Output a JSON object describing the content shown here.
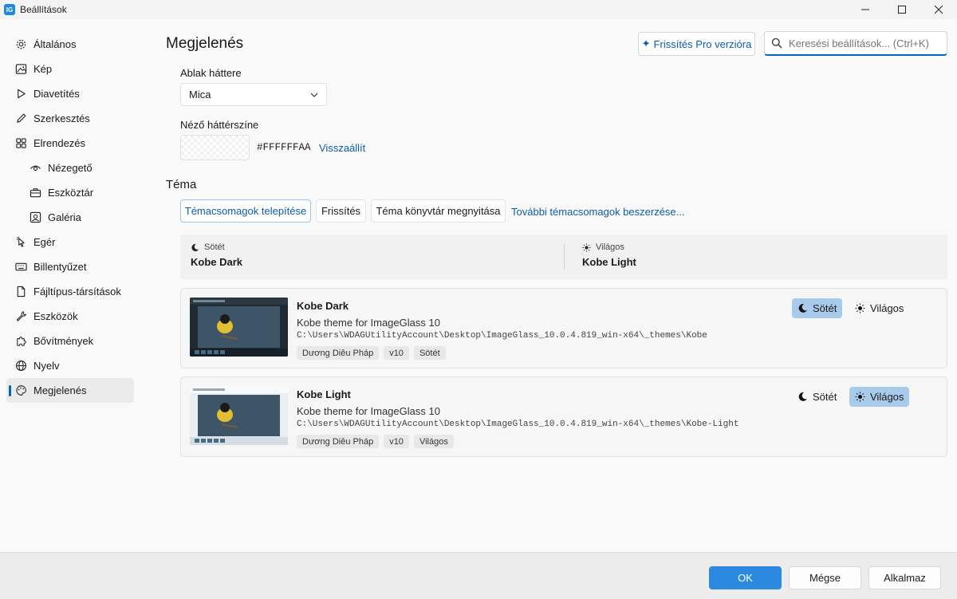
{
  "window": {
    "title": "Beállítások",
    "app_icon": "IG"
  },
  "sidebar": {
    "items": [
      {
        "label": "Általános",
        "icon": "gear-icon"
      },
      {
        "label": "Kép",
        "icon": "image-icon"
      },
      {
        "label": "Diavetítés",
        "icon": "play-icon"
      },
      {
        "label": "Szerkesztés",
        "icon": "pencil-icon"
      },
      {
        "label": "Elrendezés",
        "icon": "grid-icon"
      },
      {
        "label": "Nézegető",
        "icon": "eye-icon"
      },
      {
        "label": "Eszköztár",
        "icon": "toolbox-icon"
      },
      {
        "label": "Galéria",
        "icon": "gallery-icon"
      },
      {
        "label": "Egér",
        "icon": "mouse-pointer-icon"
      },
      {
        "label": "Billentyűzet",
        "icon": "keyboard-icon"
      },
      {
        "label": "Fájltípus-társítások",
        "icon": "file-icon"
      },
      {
        "label": "Eszközök",
        "icon": "wrench-icon"
      },
      {
        "label": "Bővítmények",
        "icon": "puzzle-icon"
      },
      {
        "label": "Nyelv",
        "icon": "globe-icon"
      },
      {
        "label": "Megjelenés",
        "icon": "palette-icon"
      }
    ]
  },
  "header": {
    "title": "Megjelenés",
    "pro_button": "Frissítés Pro verzióra",
    "search_placeholder": "Keresési beállítások... (Ctrl+K)"
  },
  "background": {
    "window_bg_label": "Ablak háttere",
    "window_bg_value": "Mica",
    "viewer_bg_label": "Néző háttérszíne",
    "viewer_bg_value": "#FFFFFFAA",
    "reset_label": "Visszaállít"
  },
  "theme": {
    "section_title": "Téma",
    "buttons": {
      "install": "Témacsomagok telepítése",
      "refresh": "Frissítés",
      "open_folder": "Téma könyvtár megnyitása",
      "more": "További témacsomagok beszerzése..."
    },
    "summary": {
      "dark_label": "Sötét",
      "dark_value": "Kobe Dark",
      "light_label": "Világos",
      "light_value": "Kobe Light"
    },
    "packs": [
      {
        "name": "Kobe Dark",
        "description": "Kobe theme for ImageGlass 10",
        "path": "C:\\Users\\WDAGUtilityAccount\\Desktop\\ImageGlass_10.0.4.819_win-x64\\_themes\\Kobe",
        "tags": [
          "Dương Diêu Pháp",
          "v10",
          "Sötét"
        ],
        "dark_btn": "Sötét",
        "light_btn": "Világos"
      },
      {
        "name": "Kobe Light",
        "description": "Kobe theme for ImageGlass 10",
        "path": "C:\\Users\\WDAGUtilityAccount\\Desktop\\ImageGlass_10.0.4.819_win-x64\\_themes\\Kobe-Light",
        "tags": [
          "Dương Diêu Pháp",
          "v10",
          "Világos"
        ],
        "dark_btn": "Sötét",
        "light_btn": "Világos"
      }
    ]
  },
  "footer": {
    "ok": "OK",
    "cancel": "Mégse",
    "apply": "Alkalmaz"
  },
  "colors": {
    "accent": "#0067c0",
    "link": "#0b5cad",
    "ok_button": "#2b8ae0",
    "selected_mode": "#a8cbec"
  }
}
